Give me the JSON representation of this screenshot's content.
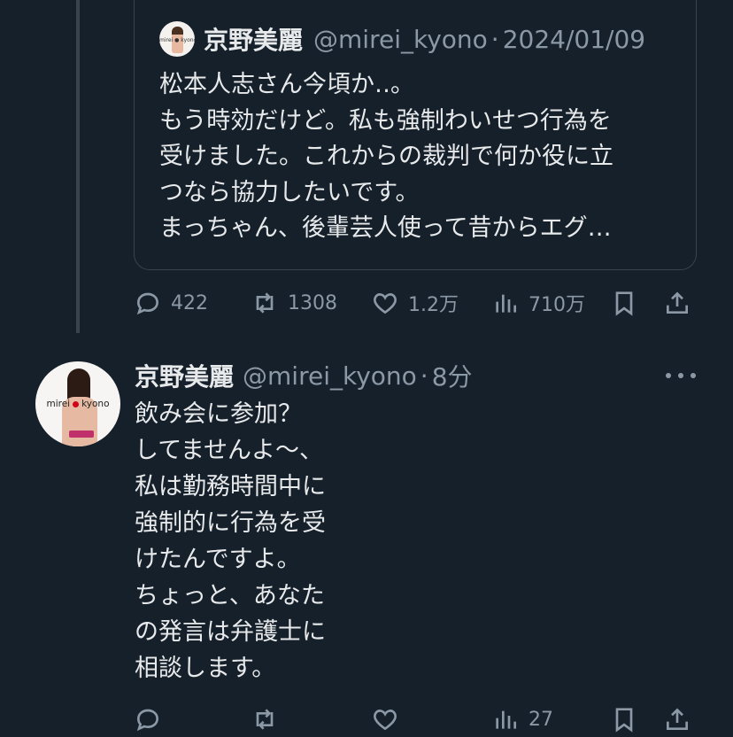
{
  "quote": {
    "name": "京野美麗",
    "handle": "@mirei_kyono",
    "date": "2024/01/09",
    "avatar_label": "mirei ● kyono",
    "text": "松本人志さん今頃か‥。\nもう時効だけど。私も強制わいせつ行為を\n受けました。これからの裁判で何か役に立\nつなら協力したいです。\nまっちゃん、後輩芸人使って昔からエグ…"
  },
  "quote_actions": {
    "replies": "422",
    "retweets": "1308",
    "likes": "1.2万",
    "views": "710万",
    "icons": [
      "reply-icon",
      "retweet-icon",
      "like-icon",
      "views-icon",
      "bookmark-icon",
      "share-icon"
    ]
  },
  "tweet": {
    "name": "京野美麗",
    "handle": "@mirei_kyono",
    "time": "8分",
    "avatar_label_left": "mirei",
    "avatar_label_right": "kyono",
    "text": "飲み会に参加？\nしてませんよ〜、\n私は勤務時間中に\n強制的に行為を受\nけたんですよ。\nちょっと、あなた\nの発言は弁護士に\n相談します。"
  },
  "tweet_actions": {
    "views": "27"
  },
  "colors": {
    "background": "#15202b",
    "text": "#e7e9ea",
    "secondary": "#8b98a5",
    "border": "#38444d"
  }
}
